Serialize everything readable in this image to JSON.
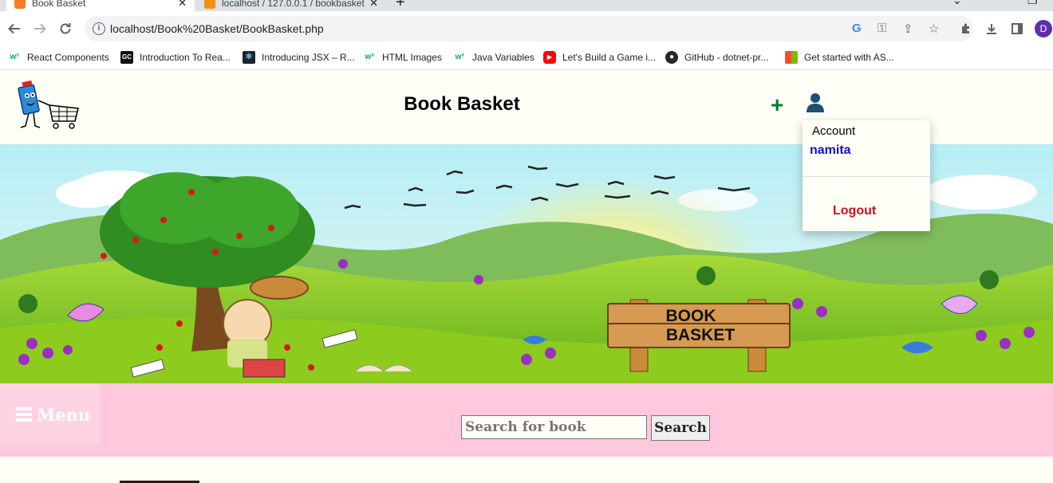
{
  "browser": {
    "tabs": [
      {
        "title": "Book Basket",
        "active": true
      },
      {
        "title": "localhost / 127.0.0.1 / bookbasket",
        "active": false
      }
    ],
    "url": "localhost/Book%20Basket/BookBasket.php",
    "profile_initial": "D",
    "bookmarks": [
      {
        "label": "React Components",
        "icon": "w3schools-icon"
      },
      {
        "label": "Introduction To Rea...",
        "icon": "gc-icon"
      },
      {
        "label": "Introducing JSX – R...",
        "icon": "react-icon"
      },
      {
        "label": "HTML Images",
        "icon": "w3schools-icon"
      },
      {
        "label": "Java Variables",
        "icon": "w3schools-icon"
      },
      {
        "label": "Let's Build a Game i...",
        "icon": "youtube-icon"
      },
      {
        "label": "GitHub - dotnet-pr...",
        "icon": "github-icon"
      },
      {
        "label": "Get started with AS...",
        "icon": "microsoft-icon"
      }
    ]
  },
  "site": {
    "title": "Book Basket",
    "sign_text_line1": "BOOK",
    "sign_text_line2": "BASKET",
    "account": {
      "label": "Account",
      "username": "namita",
      "logout_label": "Logout"
    },
    "menu_label": "Menu",
    "search": {
      "placeholder": "Search for book",
      "button_label": "Search"
    }
  },
  "colors": {
    "page_bg": "#fffff7",
    "menubar_bg": "#ffc8dc",
    "username": "#1010d0",
    "logout": "#c8101a",
    "plus_icon": "#0a7a2a"
  }
}
